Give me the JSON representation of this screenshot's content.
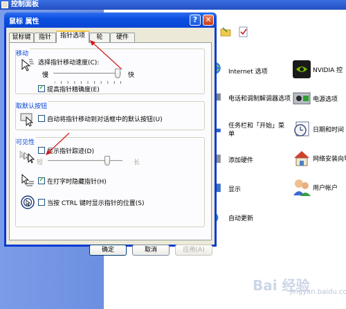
{
  "control_panel": {
    "title": "控制面板",
    "items": [
      {
        "label": "Internet 选项",
        "icon": "internet-options-icon"
      },
      {
        "label": "NVIDIA 控",
        "icon": "nvidia-icon"
      },
      {
        "label": "电话和调制解调器选项",
        "icon": "phone-modem-icon"
      },
      {
        "label": "电源选项",
        "icon": "power-options-icon"
      },
      {
        "label": "任务栏和「开始」菜单",
        "icon": "taskbar-start-icon"
      },
      {
        "label": "日期和时间",
        "icon": "date-time-icon"
      },
      {
        "label": "添加硬件",
        "icon": "add-hardware-icon"
      },
      {
        "label": "网络安装向导",
        "icon": "network-setup-icon"
      },
      {
        "label": "显示",
        "icon": "display-icon"
      },
      {
        "label": "用户帐户",
        "icon": "user-accounts-icon"
      },
      {
        "label": "自动更新",
        "icon": "auto-update-icon"
      }
    ],
    "watermark": {
      "brand": "Bai 经验",
      "sub": "jingyan.baidu.com"
    }
  },
  "dialog": {
    "title": "鼠标 属性",
    "help": "?",
    "close": "✕",
    "tabs": [
      "鼠标键",
      "指针",
      "指针选项",
      "轮",
      "硬件"
    ],
    "active_tab": "指针选项",
    "motion": {
      "title": "移动",
      "speed_label": "选择指针移动速度(C):",
      "slow": "慢",
      "fast": "快",
      "speed_value": 0.95,
      "precision_label": "提高指针精确度(E)",
      "precision_checked": true
    },
    "snap": {
      "title": "取默认按钮",
      "label": "自动将指针移动到对话框中的默认按钮(U)",
      "checked": false
    },
    "visibility": {
      "title": "可见性",
      "trails_label": "显示指针踪迹(D)",
      "trails_checked": false,
      "short": "短",
      "long": "长",
      "trails_value": 0.8,
      "hide_label": "在打字时隐藏指针(H)",
      "hide_checked": true,
      "ctrl_label": "当按 CTRL 键时显示指针的位置(S)",
      "ctrl_checked": false
    },
    "buttons": {
      "ok": "确定",
      "cancel": "取消",
      "apply": "应用(A)"
    },
    "colors": {
      "title_blue": "#0a46d4",
      "group_title": "#0046d5",
      "annotation": "#d01818"
    }
  }
}
